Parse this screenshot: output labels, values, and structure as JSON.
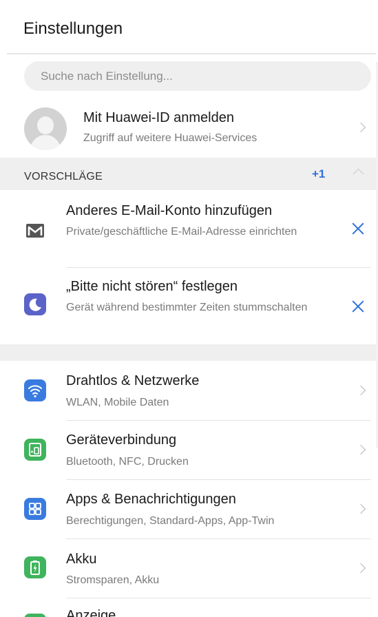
{
  "header": {
    "title": "Einstellungen"
  },
  "search": {
    "placeholder": "Suche nach Einstellung..."
  },
  "account": {
    "title": "Mit Huawei-ID anmelden",
    "subtitle": "Zugriff auf weitere Huawei-Services"
  },
  "suggestions": {
    "label": "VORSCHLÄGE",
    "count": "+1",
    "items": [
      {
        "title": "Anderes E-Mail-Konto hinzufügen",
        "subtitle": "Private/geschäftliche E-Mail-Adresse einrichten",
        "icon": "mail-icon"
      },
      {
        "title": "„Bitte nicht stören“ festlegen",
        "subtitle": "Gerät während bestimmter Zeiten stummschalten",
        "icon": "moon-icon"
      }
    ]
  },
  "settings": [
    {
      "title": "Drahtlos & Netzwerke",
      "subtitle": "WLAN, Mobile Daten",
      "icon": "wifi-icon",
      "color": "#3a7be0"
    },
    {
      "title": "Geräteverbindung",
      "subtitle": "Bluetooth, NFC, Drucken",
      "icon": "device-connection-icon",
      "color": "#3fb45c"
    },
    {
      "title": "Apps & Benachrichtigungen",
      "subtitle": "Berechtigungen, Standard-Apps, App-Twin",
      "icon": "apps-icon",
      "color": "#3a7be0"
    },
    {
      "title": "Akku",
      "subtitle": "Stromsparen, Akku",
      "icon": "battery-icon",
      "color": "#3fb45c"
    },
    {
      "title": "Anzeige",
      "subtitle": "",
      "icon": "display-icon",
      "color": "#3fb45c"
    }
  ],
  "colors": {
    "accent": "#2f6fdc",
    "dnd": "#5b63c8",
    "mail": "#555555"
  }
}
